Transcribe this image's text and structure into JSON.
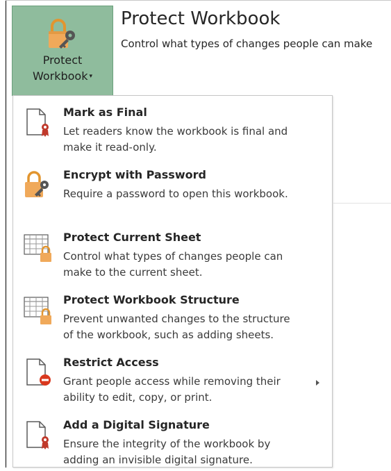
{
  "protect_button": {
    "label_line1": "Protect",
    "label_line2": "Workbook",
    "caret": "▾",
    "icon": "lock-key-icon"
  },
  "header": {
    "title": "Protect Workbook",
    "description": "Control what types of changes people can make"
  },
  "menu": {
    "items": [
      {
        "title": "Mark as Final",
        "description": "Let readers know the workbook is final and\nmake it read-only.",
        "icon": "document-ribbon-icon"
      },
      {
        "title": "Encrypt with Password",
        "description": "Require a password to open this workbook.",
        "icon": "lock-key-icon"
      },
      {
        "title": "Protect Current Sheet",
        "description": "Control what types of changes people can\nmake to the current sheet.",
        "icon": "sheet-lock-icon"
      },
      {
        "title": "Protect Workbook Structure",
        "description": "Prevent unwanted changes to the structure\nof the workbook, such as adding sheets.",
        "icon": "workbook-lock-icon"
      },
      {
        "title": "Restrict Access",
        "description": "Grant people access while removing their\nability to edit, copy, or print.",
        "icon": "document-restrict-icon",
        "has_submenu": true
      },
      {
        "title": "Add a Digital Signature",
        "description": "Ensure the integrity of the workbook by\nadding an invisible digital signature.",
        "icon": "document-ribbon-icon"
      }
    ]
  },
  "colors": {
    "button_bg": "#8fbc9d",
    "lock_orange": "#f0a95a",
    "key_gray": "#555555",
    "ribbon_red": "#c0392b",
    "restrict_red": "#d9381e"
  }
}
